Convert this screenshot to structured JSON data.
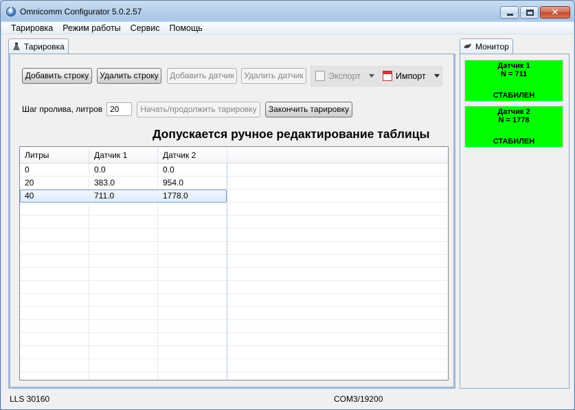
{
  "window": {
    "title": "Omnicomm Configurator 5.0.2.57",
    "close_glyph": "✕"
  },
  "menu": [
    "Тарировка",
    "Режим работы",
    "Сервис",
    "Помощь"
  ],
  "tabs": {
    "left": "Тарировка",
    "right": "Монитор"
  },
  "toolbar": {
    "add_row": "Добавить строку",
    "delete_row": "Удалить строку",
    "add_sensor": "Добавить датчик",
    "delete_sensor": "Удалить датчик",
    "export": "Экспорт",
    "import": "Импорт"
  },
  "step": {
    "label": "Шаг пролива, литров",
    "value": "20",
    "start_button": "Начать/продолжить тарировку",
    "finish_button": "Закончить тарировку"
  },
  "note": "Допускается ручное редактирование таблицы",
  "table": {
    "columns": [
      "Литры",
      "Датчик 1",
      "Датчик 2"
    ],
    "rows": [
      [
        "0",
        "0.0",
        "0.0"
      ],
      [
        "20",
        "383.0",
        "954.0"
      ],
      [
        "40",
        "711.0",
        "1778.0"
      ]
    ],
    "selected_row": 2
  },
  "monitor": {
    "sensors": [
      {
        "name": "Датчик 1",
        "value": "N =  711",
        "status": "СТАБИЛЕН",
        "color": "#00ff00"
      },
      {
        "name": "Датчик 2",
        "value": "N = 1778",
        "status": "СТАБИЛЕН",
        "color": "#00ff00"
      }
    ]
  },
  "status": {
    "device": "LLS 30160",
    "port": "COM3/19200"
  }
}
